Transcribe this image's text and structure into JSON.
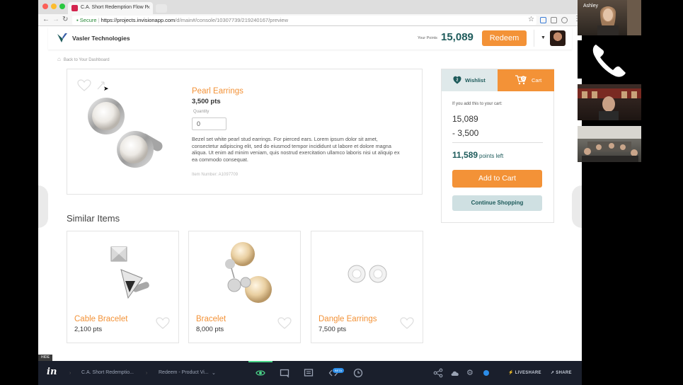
{
  "browser": {
    "tab_title": "C.A. Short Redemption Flow P",
    "tab_close": "×",
    "url_secure": "Secure",
    "url_domain": "https://projects.invisionapp.com",
    "url_path": "/d/main#/console/10307739/219240167/preview"
  },
  "header": {
    "brand": "Vasler Technologies",
    "points_label": "Your Points",
    "points_value": "15,089",
    "redeem_label": "Redeem"
  },
  "breadcrumb": {
    "back_label": "Back to Your Dashboard"
  },
  "product": {
    "name": "Pearl Earrings",
    "price": "3,500 pts",
    "quantity_label": "Quantity",
    "quantity_value": "0",
    "description": "Bezel set white pearl stud earrings. For pierced ears. Lorem ipsum dolor sit amet, consectetur adipiscing elit, sed do eiusmod tempor incididunt ut labore et dolore magna aliqua. Ut enim ad minim veniam, quis nostrud exercitation ullamco laboris nisi ut aliquip ex ea commodo consequat.",
    "item_number": "Item Number: A1097709"
  },
  "cart_panel": {
    "wishlist_tab": "Wishlist",
    "wishlist_count": "2",
    "cart_tab": "Cart",
    "cart_count": "0",
    "note": "If you add this to your cart:",
    "current_points": "15,089",
    "subtract_points": "- 3,500",
    "remaining_points": "11,589",
    "remaining_label": "points left",
    "add_to_cart": "Add to Cart",
    "continue_shopping": "Continue Shopping"
  },
  "similar": {
    "title": "Similar Items",
    "items": [
      {
        "name": "Cable Bracelet",
        "price": "2,100 pts"
      },
      {
        "name": "Bracelet",
        "price": "8,000 pts"
      },
      {
        "name": "Dangle Earrings",
        "price": "7,500 pts"
      }
    ]
  },
  "footer": {
    "hide_label": "HIDE",
    "project_crumb": "C.A. Short Redemptio...",
    "screen_crumb": "Redeem - Product Vi...",
    "beta_badge": "BETA",
    "liveshare": "LIVESHARE",
    "share": "SHARE"
  },
  "call": {
    "participant_name": "Ashley"
  },
  "colors": {
    "accent_orange": "#f39237",
    "brand_teal": "#1e5b5b",
    "footer_bg": "#1a1f2c"
  }
}
